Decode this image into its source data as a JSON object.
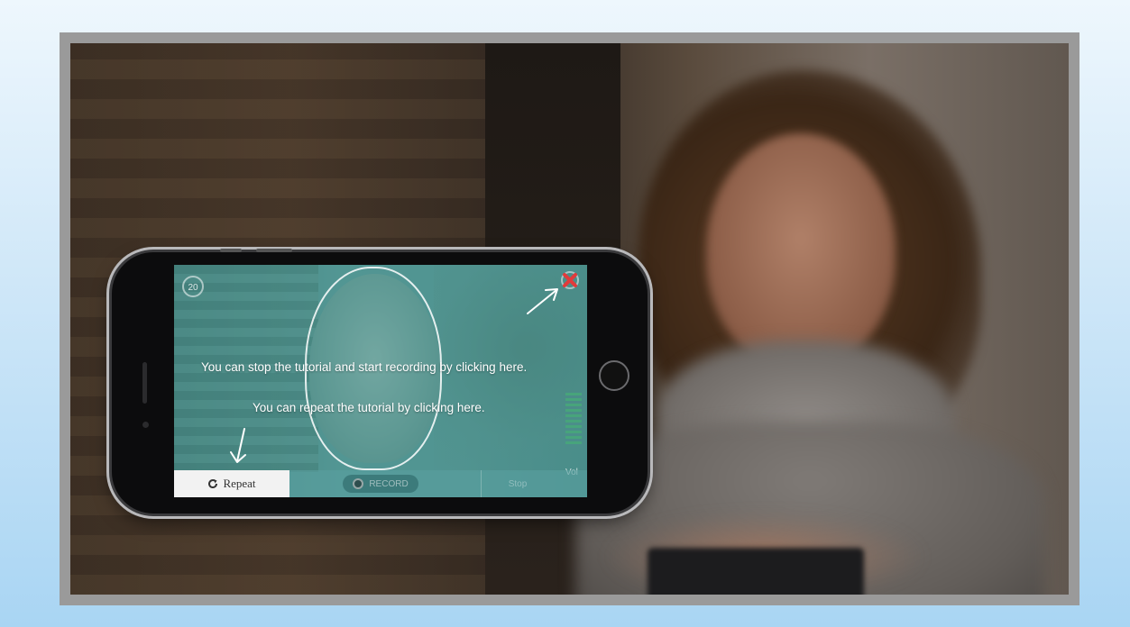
{
  "tutorial": {
    "stop_text": "You can stop the tutorial and start recording by clicking here.",
    "repeat_text": "You can repeat the tutorial by clicking here."
  },
  "recorder": {
    "timer": "20",
    "volume_label": "Vol"
  },
  "controls": {
    "repeat_label": "Repeat",
    "record_label": "RECORD",
    "stop_label": "Stop"
  },
  "icons": {
    "close": "close-x-icon",
    "repeat": "refresh-icon",
    "record": "record-dot-icon"
  },
  "colors": {
    "overlay_teal": "#5fa3a0",
    "close_red": "#e23b3b",
    "repeat_bg": "#f2f2f2"
  }
}
